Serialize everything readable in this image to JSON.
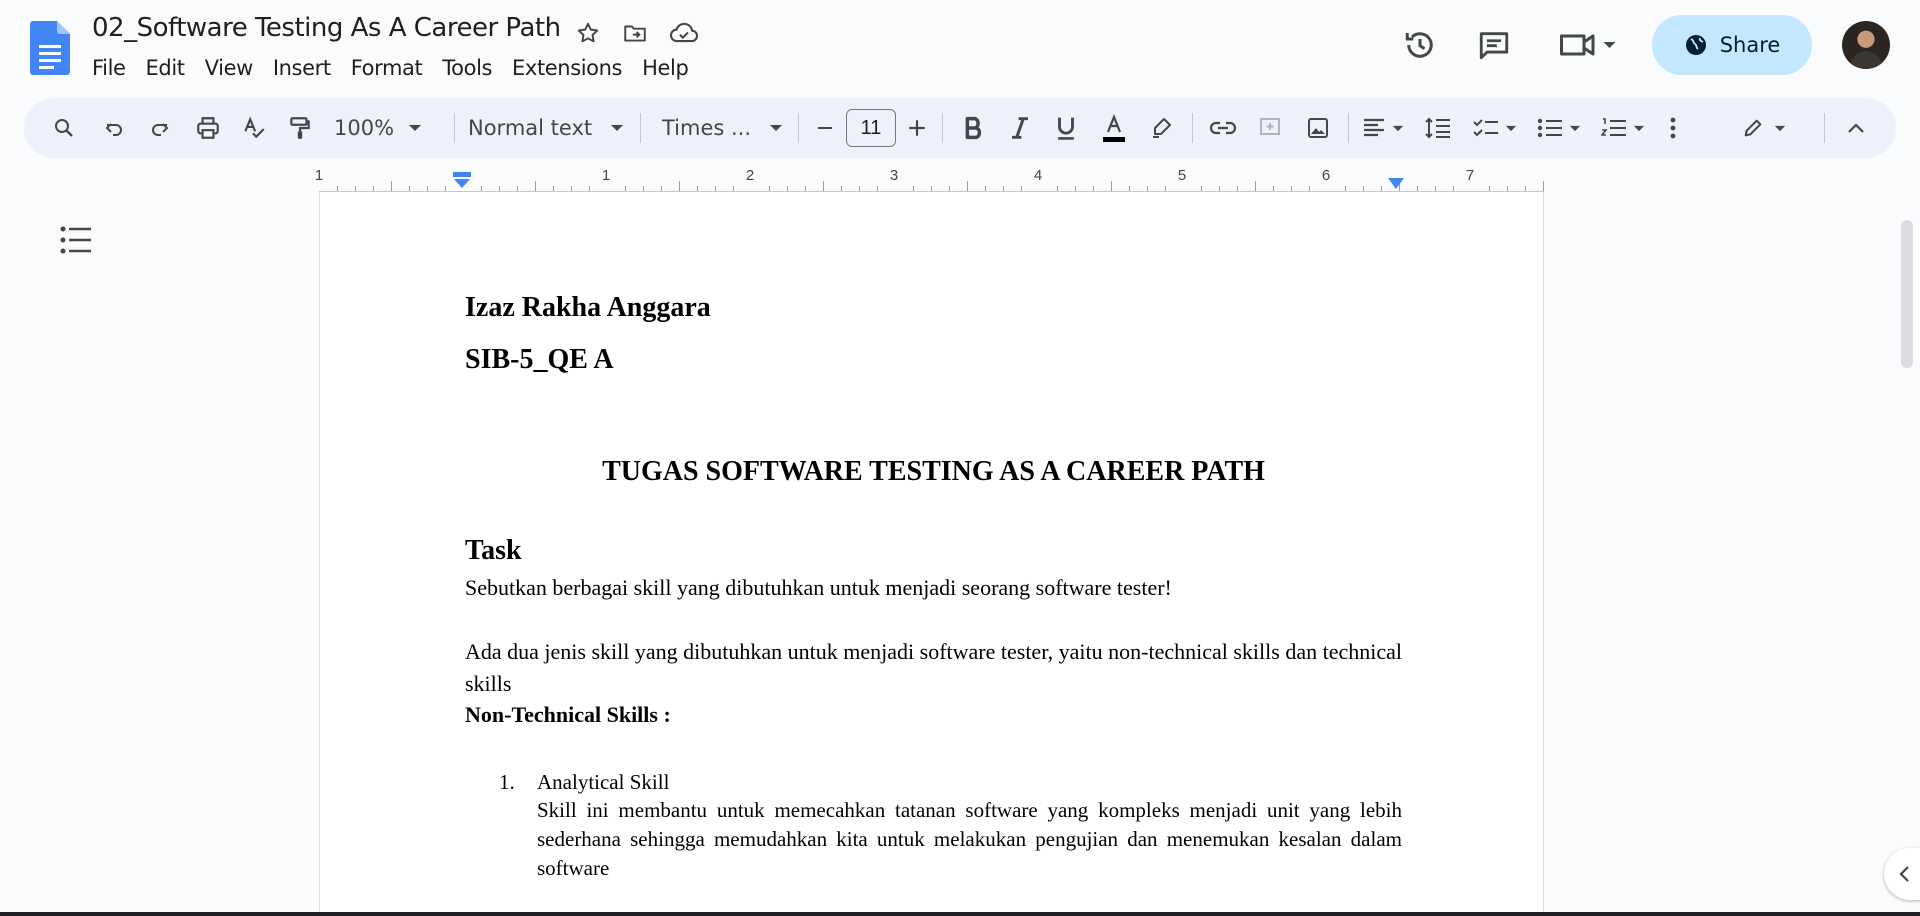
{
  "document": {
    "title": "02_Software Testing As A Career Path"
  },
  "menu": [
    "File",
    "Edit",
    "View",
    "Insert",
    "Format",
    "Tools",
    "Extensions",
    "Help"
  ],
  "header": {
    "share_label": "Share"
  },
  "toolbar": {
    "zoom": "100%",
    "style": "Normal text",
    "font": "Times ...",
    "font_size": "11"
  },
  "ruler": {
    "numbers": [
      "1",
      "1",
      "2",
      "3",
      "4",
      "5",
      "6",
      "7"
    ]
  },
  "content": {
    "name": "Izaz Rakha Anggara",
    "class": "SIB-5_QE A",
    "heading": "TUGAS SOFTWARE TESTING AS A CAREER PATH",
    "task_label": "Task",
    "question": "Sebutkan berbagai skill yang dibutuhkan untuk menjadi seorang software tester!",
    "answer": "Ada dua jenis skill yang dibutuhkan untuk menjadi software tester, yaitu non-technical skills dan technical skills",
    "nontech_label": "Non-Technical Skills :",
    "list_item_1": {
      "number": "1.",
      "title": "Analytical Skill",
      "body": "Skill ini membantu untuk memecahkan tatanan software yang kompleks menjadi unit yang lebih sederhana sehingga memudahkan kita untuk melakukan pengujian dan menemukan kesalan dalam software"
    }
  },
  "colors": {
    "accent_blue": "#4285f4",
    "share_bg": "#c2e7ff",
    "toolbar_bg": "#edf2fa"
  },
  "icons": {
    "logo": "google-docs-logo-icon",
    "star": "star-icon",
    "move": "folder-move-icon",
    "cloud": "cloud-saved-icon",
    "history": "history-icon",
    "comments": "comment-icon",
    "meet": "video-camera-icon",
    "share": "globe-icon"
  }
}
